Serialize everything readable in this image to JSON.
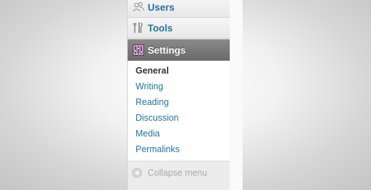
{
  "admin_menu": {
    "items": [
      {
        "label": "Users",
        "icon": "users-icon"
      },
      {
        "label": "Tools",
        "icon": "tools-icon"
      },
      {
        "label": "Settings",
        "icon": "settings-icon",
        "current": true
      }
    ],
    "settings_submenu": [
      {
        "label": "General",
        "current": true
      },
      {
        "label": "Writing"
      },
      {
        "label": "Reading"
      },
      {
        "label": "Discussion"
      },
      {
        "label": "Media"
      },
      {
        "label": "Permalinks"
      }
    ],
    "collapse_label": "Collapse menu",
    "collapse_icon": "collapse-arrow-icon"
  },
  "colors": {
    "link": "#21759b",
    "current_bg": "#6a6a6a",
    "current_text": "#ffffff",
    "muted": "#aaaaaa"
  }
}
